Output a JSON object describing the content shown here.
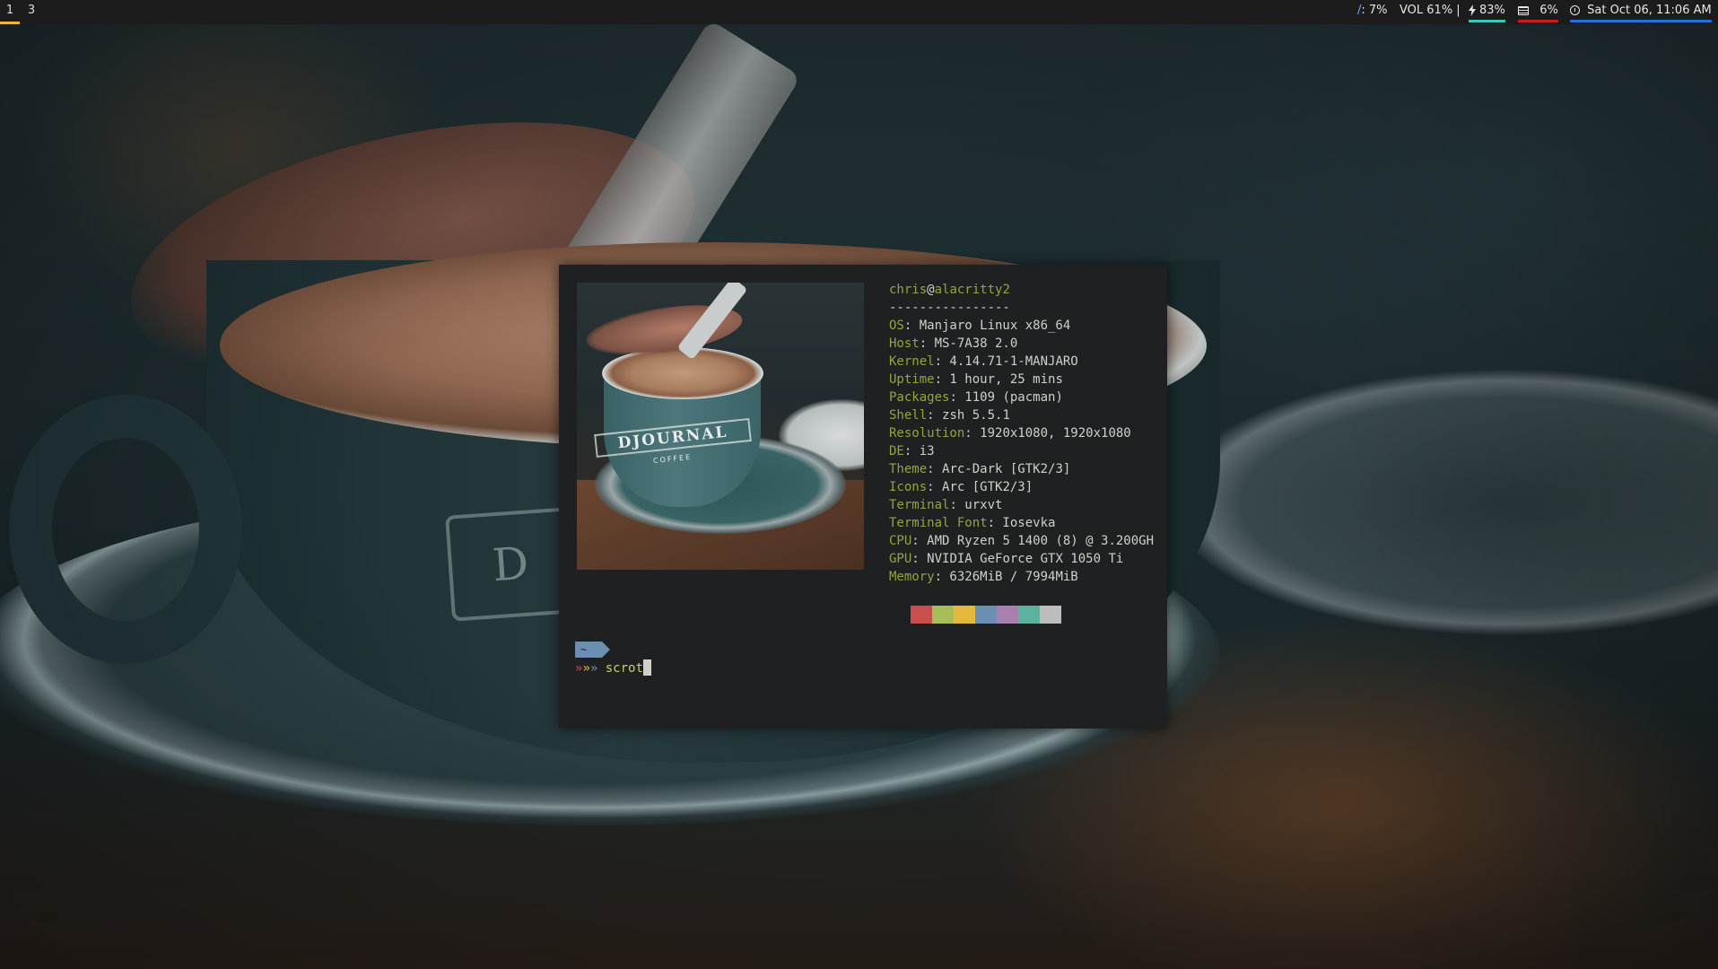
{
  "bar": {
    "workspaces": [
      {
        "label": "1",
        "focused": true
      },
      {
        "label": "3",
        "focused": false
      }
    ],
    "status": {
      "cpu_prefix": "/",
      "cpu_text": ": 7%",
      "volume_text": "VOL 61% |",
      "battery_icon": "bolt-icon",
      "battery_text": "83%",
      "battery_color": "#39c6bd",
      "disk_icon": "disk-icon",
      "disk_text": "6%",
      "disk_color": "#c51d1d",
      "clock_icon": "clock-icon",
      "datetime_text": "Sat Oct 06, 11:06 AM",
      "datetime_color": "#1f73d8"
    },
    "focus_color": "#e7b83e"
  },
  "terminal": {
    "ascii_image_text": "DJOURNAL",
    "ascii_image_subtext": "COFFEE",
    "user": "chris",
    "at": "@",
    "host": "alacritty2",
    "separator": "----------------",
    "info": [
      {
        "key": "OS",
        "value": ": Manjaro Linux x86_64"
      },
      {
        "key": "Host",
        "value": ": MS-7A38 2.0"
      },
      {
        "key": "Kernel",
        "value": ": 4.14.71-1-MANJARO"
      },
      {
        "key": "Uptime",
        "value": ": 1 hour, 25 mins"
      },
      {
        "key": "Packages",
        "value": ": 1109 (pacman)"
      },
      {
        "key": "Shell",
        "value": ": zsh 5.5.1"
      },
      {
        "key": "Resolution",
        "value": ": 1920x1080, 1920x1080"
      },
      {
        "key": "DE",
        "value": ": i3"
      },
      {
        "key": "Theme",
        "value": ": Arc-Dark [GTK2/3]"
      },
      {
        "key": "Icons",
        "value": ": Arc [GTK2/3]"
      },
      {
        "key": "Terminal",
        "value": ": urxvt"
      },
      {
        "key": "Terminal Font",
        "value": ": Iosevka"
      },
      {
        "key": "CPU",
        "value": ": AMD Ryzen 5 1400 (8) @ 3.200GH"
      },
      {
        "key": "GPU",
        "value": ": NVIDIA GeForce GTX 1050 Ti"
      },
      {
        "key": "Memory",
        "value": ": 6326MiB / 7994MiB"
      }
    ],
    "palette": [
      "#1e2022",
      "#c5504c",
      "#a7bd5a",
      "#e7b83e",
      "#6b8fb3",
      "#a77fb0",
      "#5cb39d",
      "#bdbdbd"
    ],
    "prompt": {
      "dir": "~",
      "chevrons": [
        "»",
        "»",
        "»"
      ],
      "command": "scrot"
    }
  }
}
